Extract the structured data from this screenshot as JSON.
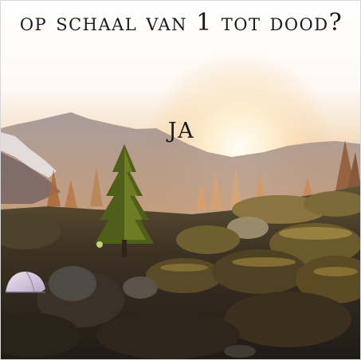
{
  "meme": {
    "question": "op schaal van 1 tot dood?",
    "answer": "JA"
  },
  "photo": {
    "scene": "sunset-mountain-meadow",
    "elements": [
      "mountain-range",
      "sun-glow",
      "conifer-trees",
      "mossy-boulders",
      "tent"
    ],
    "colors": {
      "sky_top": "#ffffff",
      "sky_glow": "#f6d9b6",
      "sun": "#fff6e3",
      "mountain": "#8a7d83",
      "ground_dark": "#2c2620",
      "moss": "#7a6a2e",
      "tree": "#5b6a1e",
      "tent": "#d7c9df"
    }
  }
}
